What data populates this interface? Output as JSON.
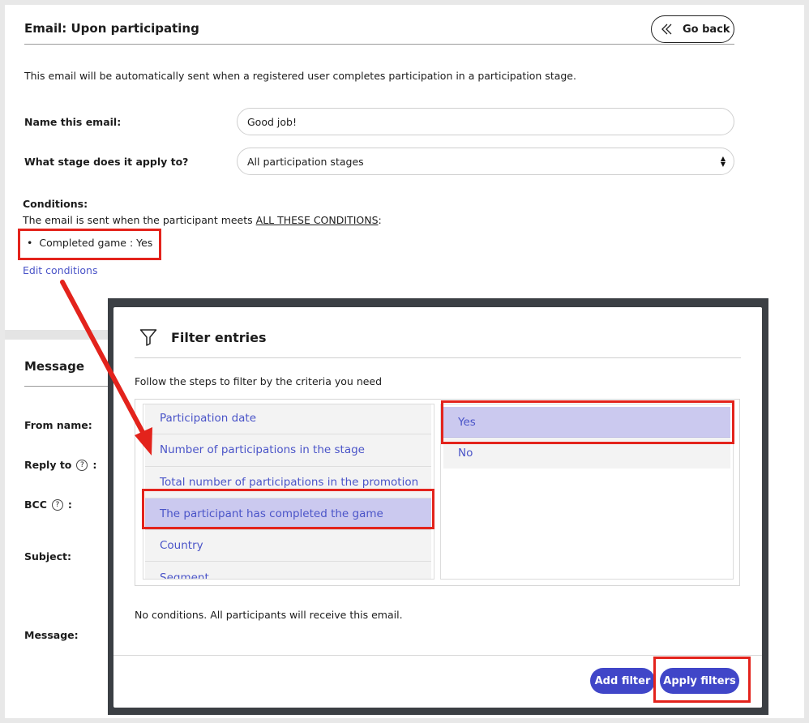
{
  "header": {
    "title": "Email: Upon participating",
    "go_back_label": "Go back"
  },
  "description": "This email will be automatically sent when a registered user completes participation in a participation stage.",
  "form": {
    "name_label": "Name this email:",
    "name_value": "Good job!",
    "stage_label": "What stage does it apply to?",
    "stage_value": "All participation stages"
  },
  "conditions": {
    "title": "Conditions:",
    "text_prefix": "The email is sent when the participant meets ",
    "text_emphasis": "ALL THESE CONDITIONS",
    "text_suffix": ":",
    "items": [
      "Completed game : Yes"
    ],
    "edit_link": "Edit conditions"
  },
  "message_section": {
    "title": "Message",
    "from_label": "From name:",
    "reply_label": "Reply to",
    "bcc_label": "BCC",
    "subject_label": "Subject:",
    "message_label": "Message:",
    "colon": ":"
  },
  "modal": {
    "title": "Filter entries",
    "description": "Follow the steps to filter by the criteria you need",
    "criteria": [
      "Participation date",
      "Number of participations in the stage",
      "Total number of participations in the promotion",
      "The participant has completed the game",
      "Country",
      "Segment"
    ],
    "selected_criterion": "The participant has completed the game",
    "values": [
      "Yes",
      "No"
    ],
    "selected_value": "Yes",
    "status_text": "No conditions. All participants will receive this email.",
    "add_filter_label": "Add filter",
    "apply_filters_label": "Apply filters"
  },
  "colors": {
    "accent": "#4046c8",
    "link": "#4a54c8",
    "selected_bg": "#cbc9ef",
    "annotation_red": "#e3231c"
  }
}
